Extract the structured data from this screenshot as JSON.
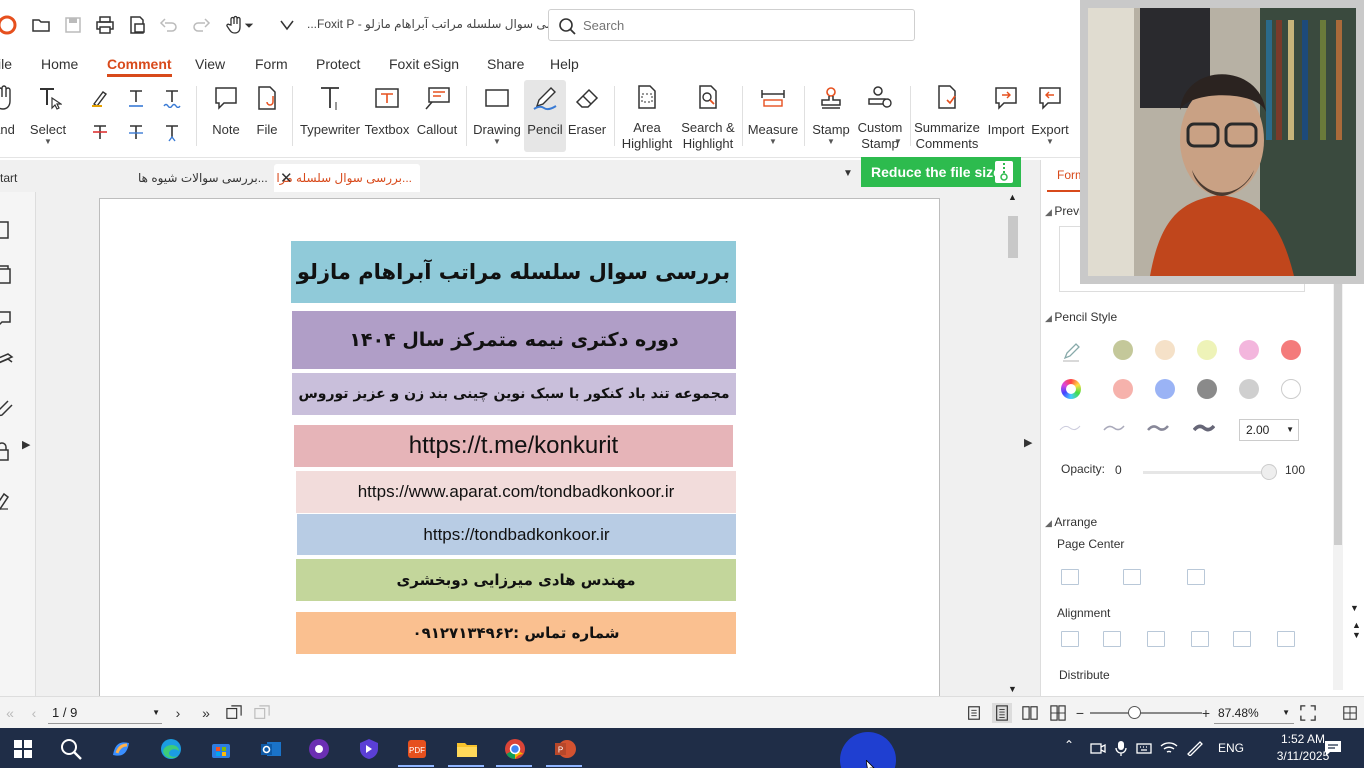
{
  "window": {
    "title": "بررسی سوال سلسله مراتب آبراهام مازلو - Foxit P..."
  },
  "search": {
    "placeholder": "Search"
  },
  "menu": [
    "ile",
    "Home",
    "Comment",
    "View",
    "Form",
    "Protect",
    "Foxit eSign",
    "Share",
    "Help"
  ],
  "ribbon": {
    "hand_label": "and",
    "select_label": "Select",
    "note_label": "Note",
    "file_label": "File",
    "typewriter_label": "Typewriter",
    "textbox_label": "Textbox",
    "callout_label": "Callout",
    "drawing_label": "Drawing",
    "pencil_label": "Pencil",
    "eraser_label": "Eraser",
    "area_highlight_label": "Area\nHighlight",
    "search_highlight_label": "Search &\nHighlight",
    "measure_label": "Measure",
    "stamp_label": "Stamp",
    "custom_stamp_label": "Custom\nStamp",
    "summarize_label": "Summarize\nComments",
    "import_label": "Import",
    "export_label": "Export"
  },
  "tabs": {
    "start": "tart",
    "tab2": "...بررسی سوالات  شیوه ها",
    "tab3": "...بررسی سوال سلسله مرا",
    "reduce": "Reduce the file size"
  },
  "document": {
    "bands": [
      {
        "text": "بررسی سوال سلسله مراتب آبراهام مازلو",
        "color": "#90cad9"
      },
      {
        "text": "دوره دکتری نیمه متمرکز سال ۱۴۰۴",
        "color": "#b09ec7"
      },
      {
        "text": "مجموعه تند باد کنکور با سبک نوین چینی بند زن و عزیز توروس",
        "color": "#c9bfdb"
      },
      {
        "text": "https://t.me/konkurit",
        "color": "#e6b4b8"
      },
      {
        "text": "https://www.aparat.com/tondbadkonkoor.ir",
        "color": "#f2dcdb"
      },
      {
        "text": "https://tondbadkonkoor.ir",
        "color": "#b8cce4"
      },
      {
        "text": "مهندس هادی میرزایی دوبخشری",
        "color": "#c3d69b"
      },
      {
        "text": "شماره تماس :۰۹۱۲۷۱۳۴۹۶۲",
        "color": "#fac090"
      }
    ]
  },
  "panel": {
    "tab_label": "Form",
    "preview_label": "Previ",
    "pencil_style_label": "Pencil Style",
    "swatches": [
      "#c4c89a",
      "#f5e1c8",
      "#eef3b8",
      "#f3b6dd",
      "#f47b7b",
      "#f6b2ac",
      "#9ab3f5",
      "#8a8a8a",
      "#cfcfcf",
      "#ffffff"
    ],
    "width_value": "2.00",
    "opacity_label": "Opacity:",
    "opacity_min": "0",
    "opacity_max": "100",
    "opacity_value": 100,
    "arrange_label": "Arrange",
    "page_center_label": "Page Center",
    "alignment_label": "Alignment",
    "distribute_label": "Distribute"
  },
  "status": {
    "page": "1 / 9",
    "zoom": "87.48%"
  },
  "taskbar": {
    "lang": "ENG",
    "time": "1:52 AM",
    "date": "3/11/2025"
  }
}
